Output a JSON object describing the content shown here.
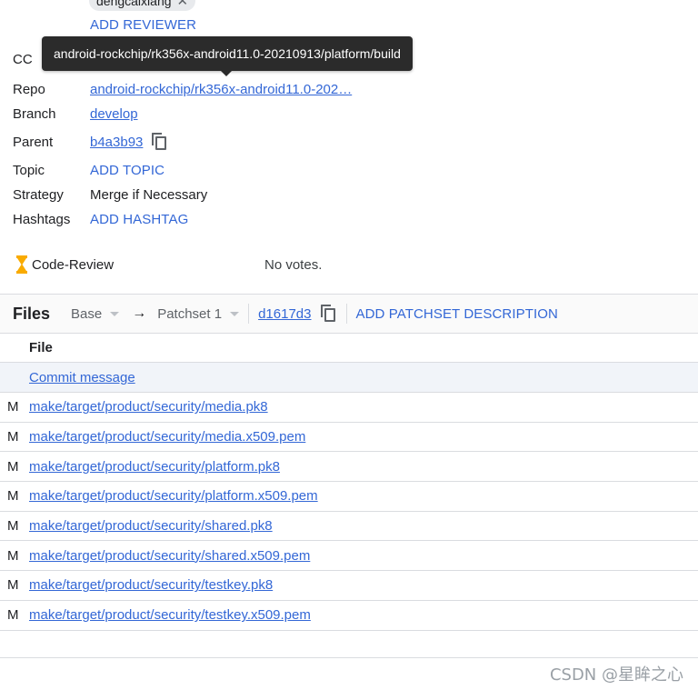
{
  "reviewer_chip": {
    "name": "dengcaixiang",
    "remove_icon": "close-icon"
  },
  "add_reviewer_label": "ADD REVIEWER",
  "tooltip": "android-rockchip/rk356x-android11.0-20210913/platform/build",
  "meta": {
    "cc_label": "CC",
    "repo_label": "Repo",
    "repo_value": "android-rockchip/rk356x-android11.0-202…",
    "branch_label": "Branch",
    "branch_value": "develop",
    "parent_label": "Parent",
    "parent_value": "b4a3b93",
    "topic_label": "Topic",
    "topic_value": "ADD TOPIC",
    "strategy_label": "Strategy",
    "strategy_value": "Merge if Necessary",
    "hashtags_label": "Hashtags",
    "hashtags_value": "ADD HASHTAG"
  },
  "code_review": {
    "label": "Code-Review",
    "votes": "No votes.",
    "icon": "hourglass-icon"
  },
  "files": {
    "title": "Files",
    "base": "Base",
    "arrow": "→",
    "patchset": "Patchset 1",
    "commit_hash": "d1617d3",
    "add_patchset_description": "ADD PATCHSET DESCRIPTION",
    "column_file": "File",
    "commit_message": "Commit message",
    "rows": [
      {
        "status": "M",
        "path": "make/target/product/security/media.pk8"
      },
      {
        "status": "M",
        "path": "make/target/product/security/media.x509.pem"
      },
      {
        "status": "M",
        "path": "make/target/product/security/platform.pk8"
      },
      {
        "status": "M",
        "path": "make/target/product/security/platform.x509.pem"
      },
      {
        "status": "M",
        "path": "make/target/product/security/shared.pk8"
      },
      {
        "status": "M",
        "path": "make/target/product/security/shared.x509.pem"
      },
      {
        "status": "M",
        "path": "make/target/product/security/testkey.pk8"
      },
      {
        "status": "M",
        "path": "make/target/product/security/testkey.x509.pem"
      }
    ]
  },
  "watermark": "CSDN @星眸之心",
  "colors": {
    "link": "#3367d6",
    "tooltip_bg": "#2b2b2b",
    "pending": "#f9ab00",
    "commit_row_bg": "#f1f4f9"
  }
}
